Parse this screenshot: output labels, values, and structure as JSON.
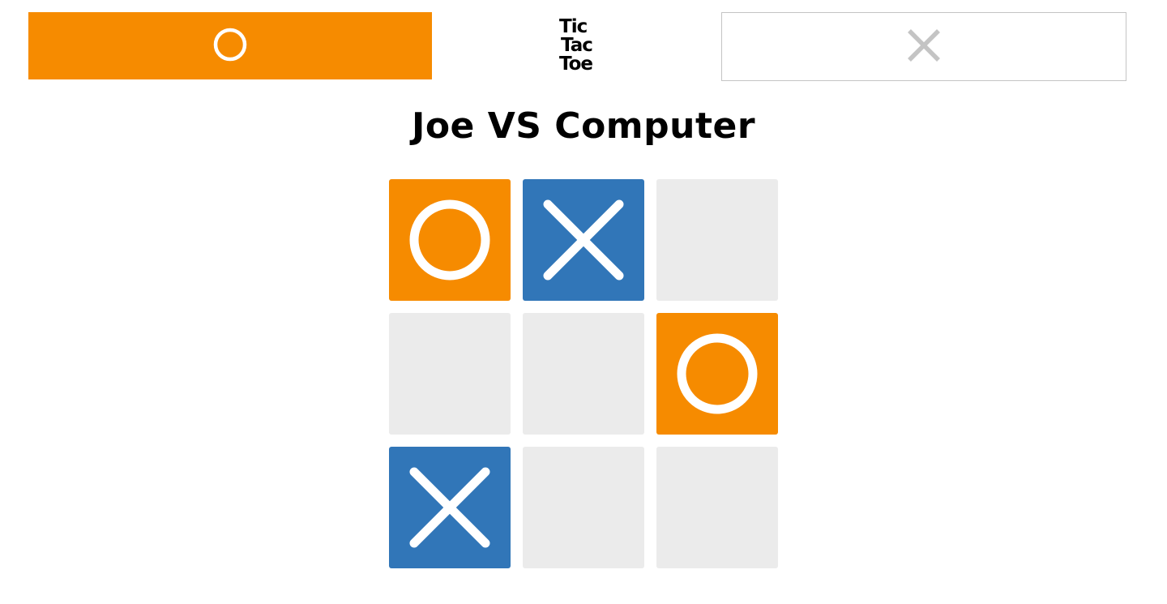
{
  "app": {
    "logo_lines": [
      "Tic",
      "Tac",
      "Toe"
    ]
  },
  "players": [
    {
      "symbol": "O",
      "icon": "circle-icon",
      "status": "active",
      "color": "#f68b00"
    },
    {
      "symbol": "X",
      "icon": "cross-icon",
      "status": "inactive",
      "color": "#c4c4c4"
    }
  ],
  "match_title": "Joe VS Computer",
  "board": {
    "cells": [
      "O",
      "X",
      "",
      "",
      "",
      "O",
      "X",
      "",
      ""
    ]
  },
  "colors": {
    "o_mark": "#f68b00",
    "x_mark": "#3176b8",
    "empty_cell": "#ebebeb",
    "mark_stroke": "#ffffff",
    "inactive_icon": "#c4c4c4"
  }
}
